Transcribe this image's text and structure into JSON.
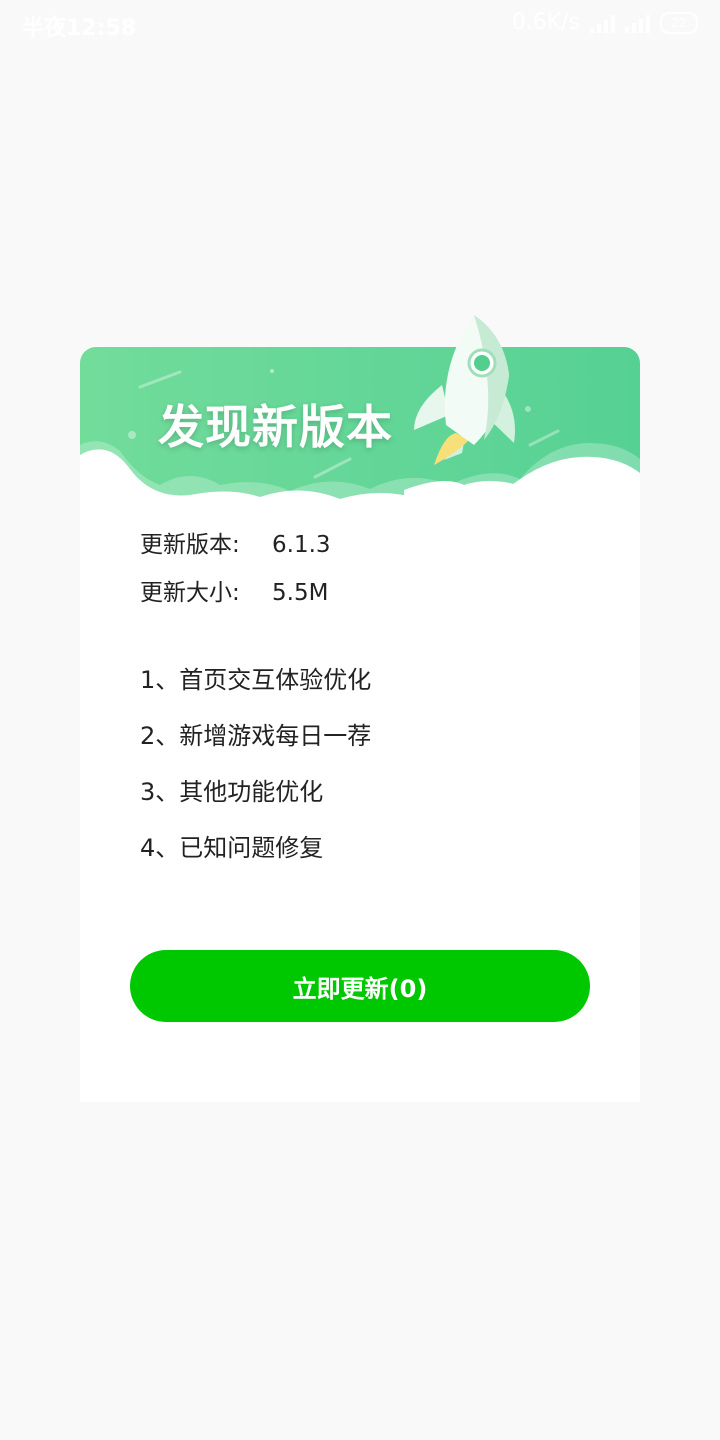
{
  "status_bar": {
    "time": "半夜12:58",
    "network_speed": "0.6K/s",
    "battery": "22"
  },
  "dialog": {
    "title": "发现新版本",
    "version_label": "更新版本:",
    "version_value": "6.1.3",
    "size_label": "更新大小:",
    "size_value": "5.5M",
    "changes": [
      "1、首页交互体验优化",
      "2、新增游戏每日一荐",
      "3、其他功能优化",
      "4、已知问题修复"
    ],
    "update_button": "立即更新(0)"
  },
  "colors": {
    "banner_green": "#5fd693",
    "button_green": "#00c800"
  },
  "icons": [
    "signal-icon",
    "wifi-icon",
    "battery-icon",
    "rocket-icon"
  ]
}
